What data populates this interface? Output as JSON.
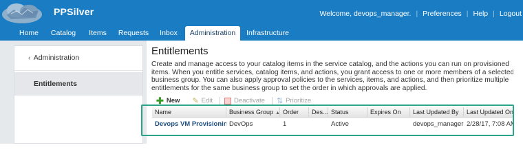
{
  "header": {
    "app_title": "PPSilver",
    "welcome": "Welcome, devops_manager.",
    "preferences": "Preferences",
    "help": "Help",
    "logout": "Logout",
    "separator": "|",
    "brand_color": "#1a7cc2"
  },
  "nav": {
    "tabs": [
      {
        "label": "Home",
        "active": false
      },
      {
        "label": "Catalog",
        "active": false
      },
      {
        "label": "Items",
        "active": false
      },
      {
        "label": "Requests",
        "active": false
      },
      {
        "label": "Inbox",
        "active": false
      },
      {
        "label": "Administration",
        "active": true
      },
      {
        "label": "Infrastructure",
        "active": false
      }
    ]
  },
  "sidebar": {
    "back_chevron": "‹",
    "back_label": "Administration",
    "selected_item": "Entitlements"
  },
  "main": {
    "title": "Entitlements",
    "description": "Create and manage access to your catalog items in the service catalog, and the actions you can run on provisioned items. When you entitle services, catalog items, and actions, you grant access to one or more members of a selected business group. You can also apply approval policies to the services, items, and actions, and then prioritize multiple entitlements for the same business group to set the order in which approvals are applied."
  },
  "toolbar": {
    "new": "New",
    "edit": "Edit",
    "deactivate": "Deactivate",
    "prioritize": "Prioritize"
  },
  "table": {
    "columns": [
      "Name",
      "Business Group",
      "Order",
      "Des...",
      "Status",
      "Expires On",
      "Last Updated By",
      "Last Updated On"
    ],
    "sort_indicator": "▲",
    "rows": [
      {
        "name": "Devops VM Provisioning",
        "business_group": "DevOps",
        "order": "1",
        "description": "",
        "status": "Active",
        "expires_on": "",
        "last_updated_by": "devops_manager",
        "last_updated_on": "2/28/17, 7:08 AM"
      }
    ]
  },
  "highlight_color": "#2aa58a"
}
